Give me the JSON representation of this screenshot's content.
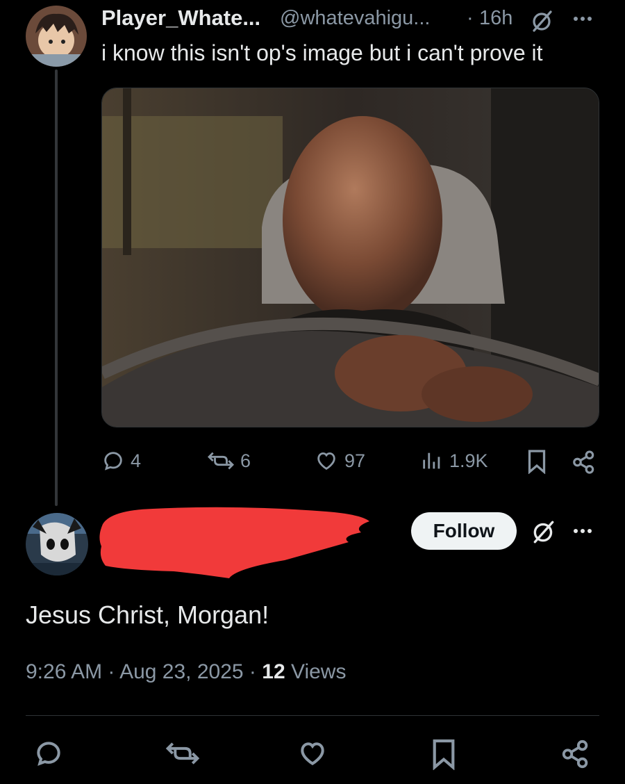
{
  "parent_tweet": {
    "display_name": "Player_Whate...",
    "handle": "@whatevahigu...",
    "separator": "·",
    "time": "16h",
    "text": "i know this isn't op's image but i can't prove it",
    "stats": {
      "replies": "4",
      "reposts": "6",
      "likes": "97",
      "views": "1.9K"
    }
  },
  "reply_tweet": {
    "follow_label": "Follow",
    "text": "Jesus Christ, Morgan!",
    "timestamp_time": "9:26 AM",
    "timestamp_sep1": " · ",
    "timestamp_date": "Aug 23, 2025",
    "timestamp_sep2": " · ",
    "views_count": "12",
    "views_label": " Views"
  },
  "colors": {
    "background": "#000000",
    "primary_text": "#e7e9ea",
    "secondary_text": "#8b98a5",
    "divider": "#2f3336",
    "redaction": "#f13a3a"
  },
  "icons": [
    "grok-icon",
    "more-icon",
    "reply-icon",
    "repost-icon",
    "like-icon",
    "views-icon",
    "bookmark-icon",
    "share-icon"
  ]
}
